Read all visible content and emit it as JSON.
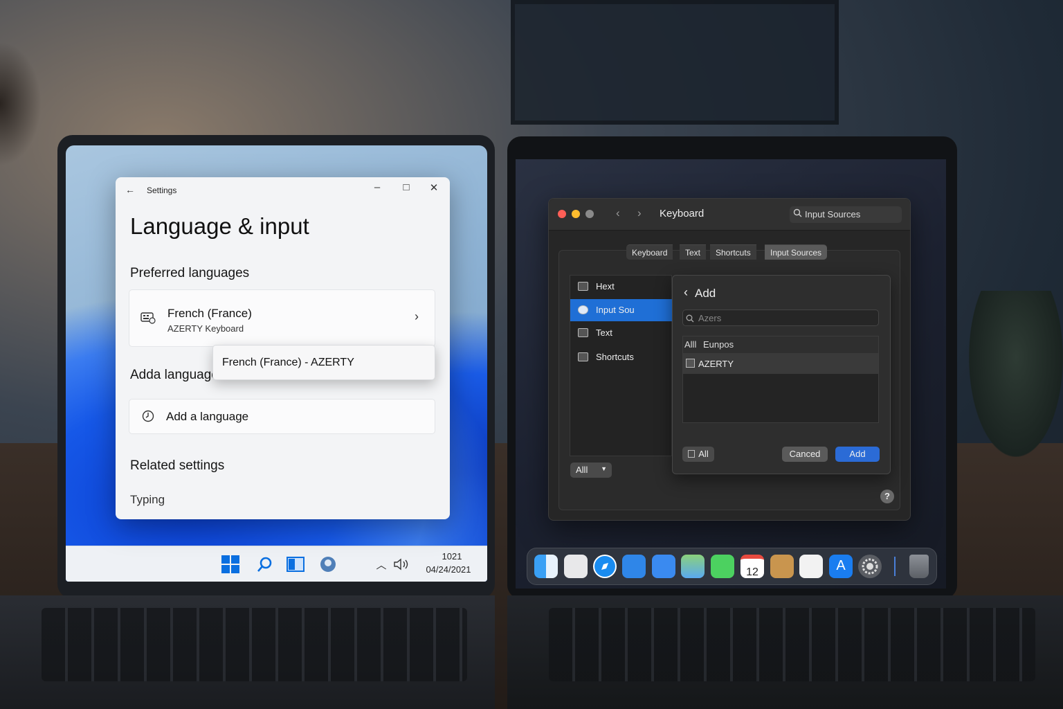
{
  "windows": {
    "settings": {
      "app_title": "Settings",
      "heading": "Language & input",
      "preferred_languages_heading": "Preferred languages",
      "language_item": {
        "name": "French (France)",
        "keyboard": "AZERTY Keyboard"
      },
      "popup_item": "French (France) - AZERTY",
      "add_language_heading": "Adda language",
      "add_language_button": "Add a language",
      "related_heading": "Related settings",
      "typing_link": "Typing"
    },
    "taskbar": {
      "time": "1021",
      "date": "04/24/2021",
      "icons": [
        "start-icon",
        "search-icon",
        "widgets-icon",
        "chat-icon"
      ]
    }
  },
  "mac": {
    "window_title": "Keyboard",
    "search_placeholder": "Input Sources",
    "tabs": [
      "Keyboard",
      "Text",
      "Shortcuts",
      "Input Sources"
    ],
    "sidebar": [
      {
        "label": "Hext",
        "icon": "keyboard-icon"
      },
      {
        "label": "Input Sou",
        "icon": "input-sources-icon"
      },
      {
        "label": "Text",
        "icon": "text-icon"
      },
      {
        "label": "Shortcuts",
        "icon": "shortcuts-icon"
      }
    ],
    "sidebar_dropdown": "Alll",
    "sheet": {
      "title": "Add",
      "search_value": "Azers",
      "filter_all": "Alll",
      "filter_region": "Eunpos",
      "list_item": "AZERTY",
      "all_button": "All",
      "cancel_button": "Canced",
      "add_button": "Add"
    },
    "help": "?",
    "dock_calendar_day": "12"
  },
  "colors": {
    "win_accent": "#0067c0",
    "mac_accent": "#2b6bd6",
    "mac_selected": "#1f6fd6"
  }
}
